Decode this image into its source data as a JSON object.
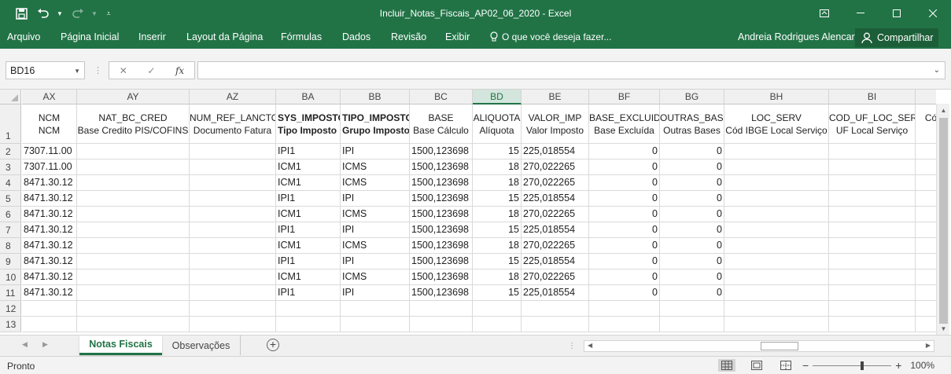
{
  "window": {
    "title": "Incluir_Notas_Fiscais_AP02_06_2020 - Excel"
  },
  "menu": {
    "items": [
      "Arquivo",
      "Página Inicial",
      "Inserir",
      "Layout da Página",
      "Fórmulas",
      "Dados",
      "Revisão",
      "Exibir"
    ],
    "tellme": "O que você deseja fazer...",
    "user": "Andreia Rodrigues Alencar",
    "share": "Compartilhar"
  },
  "formula_bar": {
    "name_box": "BD16",
    "fx": "fx",
    "value": ""
  },
  "grid": {
    "selected_column": "BD",
    "columns": [
      {
        "letter": "AX",
        "h1": "NCM",
        "h2": "NCM",
        "bold": false
      },
      {
        "letter": "AY",
        "h1": "NAT_BC_CRED",
        "h2": "Base Credito PIS/COFINS",
        "bold": false
      },
      {
        "letter": "AZ",
        "h1": "NUM_REF_LANCTO",
        "h2": "Documento Fatura",
        "bold": false
      },
      {
        "letter": "BA",
        "h1": "SYS_IMPOSTO",
        "h2": "Tipo Imposto",
        "bold": true
      },
      {
        "letter": "BB",
        "h1": "TIPO_IMPOSTO",
        "h2": "Grupo Imposto",
        "bold": true
      },
      {
        "letter": "BC",
        "h1": "BASE",
        "h2": "Base Cálculo",
        "bold": false
      },
      {
        "letter": "BD",
        "h1": "ALIQUOTA",
        "h2": "Alíquota",
        "bold": false
      },
      {
        "letter": "BE",
        "h1": "VALOR_IMP",
        "h2": "Valor Imposto",
        "bold": false
      },
      {
        "letter": "BF",
        "h1": "BASE_EXCLUIDA",
        "h2": "Base Excluída",
        "bold": false
      },
      {
        "letter": "BG",
        "h1": "OUTRAS_BASE",
        "h2": "Outras Bases",
        "bold": false
      },
      {
        "letter": "BH",
        "h1": "LOC_SERV",
        "h2": "Cód IBGE Local Serviço",
        "bold": false
      },
      {
        "letter": "BI",
        "h1": "COD_UF_LOC_SERV",
        "h2": "UF Local Serviço",
        "bold": false
      },
      {
        "letter": "",
        "h1": "",
        "h2": "Có",
        "bold": false
      }
    ],
    "row_numbers": [
      "1",
      "2",
      "3",
      "4",
      "5",
      "6",
      "7",
      "8",
      "9",
      "10",
      "11",
      "12",
      "13"
    ],
    "rows": [
      [
        "7307.11.00",
        "",
        "",
        "IPI1",
        "IPI",
        "1500,123698",
        "15",
        "225,018554",
        "0",
        "0",
        "",
        "",
        ""
      ],
      [
        "7307.11.00",
        "",
        "",
        "ICM1",
        "ICMS",
        "1500,123698",
        "18",
        "270,022265",
        "0",
        "0",
        "",
        "",
        ""
      ],
      [
        "8471.30.12",
        "",
        "",
        "ICM1",
        "ICMS",
        "1500,123698",
        "18",
        "270,022265",
        "0",
        "0",
        "",
        "",
        ""
      ],
      [
        "8471.30.12",
        "",
        "",
        "IPI1",
        "IPI",
        "1500,123698",
        "15",
        "225,018554",
        "0",
        "0",
        "",
        "",
        ""
      ],
      [
        "8471.30.12",
        "",
        "",
        "ICM1",
        "ICMS",
        "1500,123698",
        "18",
        "270,022265",
        "0",
        "0",
        "",
        "",
        ""
      ],
      [
        "8471.30.12",
        "",
        "",
        "IPI1",
        "IPI",
        "1500,123698",
        "15",
        "225,018554",
        "0",
        "0",
        "",
        "",
        ""
      ],
      [
        "8471.30.12",
        "",
        "",
        "ICM1",
        "ICMS",
        "1500,123698",
        "18",
        "270,022265",
        "0",
        "0",
        "",
        "",
        ""
      ],
      [
        "8471.30.12",
        "",
        "",
        "IPI1",
        "IPI",
        "1500,123698",
        "15",
        "225,018554",
        "0",
        "0",
        "",
        "",
        ""
      ],
      [
        "8471.30.12",
        "",
        "",
        "ICM1",
        "ICMS",
        "1500,123698",
        "18",
        "270,022265",
        "0",
        "0",
        "",
        "",
        ""
      ],
      [
        "8471.30.12",
        "",
        "",
        "IPI1",
        "IPI",
        "1500,123698",
        "15",
        "225,018554",
        "0",
        "0",
        "",
        "",
        ""
      ],
      [
        "",
        "",
        "",
        "",
        "",
        "",
        "",
        "",
        "",
        "",
        "",
        "",
        ""
      ],
      [
        "",
        "",
        "",
        "",
        "",
        "",
        "",
        "",
        "",
        "",
        "",
        "",
        ""
      ]
    ]
  },
  "sheets": {
    "tabs": [
      {
        "label": "Notas Fiscais",
        "active": true
      },
      {
        "label": "Observações",
        "active": false
      }
    ]
  },
  "status": {
    "ready": "Pronto",
    "zoom": "100%"
  },
  "colors": {
    "accent": "#217346"
  }
}
